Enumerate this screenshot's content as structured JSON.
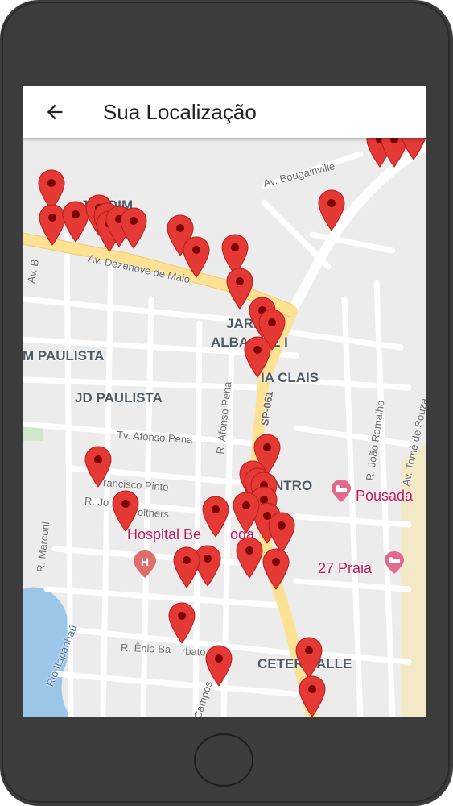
{
  "app": {
    "title": "Sua Localização"
  },
  "icons": {
    "back": "arrow-back-icon",
    "pin": "map-pin-icon",
    "hospital": "hospital-icon",
    "bed": "bed-icon"
  },
  "colors": {
    "pin": "#e53935",
    "pin_dot": "#7b0000",
    "poi": "#c2185b",
    "major_road": "#fde293",
    "water": "#9cc6e8"
  },
  "map": {
    "areas": {
      "jardim": "JARDIM",
      "jardim_alba": "JARDIM",
      "alba_rest": "ALBA",
      "alba_suffix": "Z I",
      "m_paulista": "M PAULISTA",
      "jd_paulista": "JD PAULISTA",
      "clais": "IA CLAIS",
      "centro": "NTRO",
      "ceter": "CETER",
      "alle": "ALLE"
    },
    "streets": {
      "av_bougainville": "Av. Bougainville",
      "av_dezenove": "Av. Dezenove de Maio",
      "av_b": "Av. B",
      "r_afonso": "R. Afonso Pena",
      "sp061": "SP-061",
      "tv_afonso": "Tv. Afonso Pena",
      "francisco": "rancisco Pinto",
      "r_jo": "R. Jo",
      "olthers": "olthers",
      "r_marconi": "R. Marconi",
      "rio": "Rio Itapanhaú",
      "r_enio": "R. Ênio Ba",
      "rbato": "rbato",
      "campos": "Campos",
      "r_joao_ramalho": "R. João Ramalho",
      "av_tome": "Av. Tomé de Souza"
    },
    "pois": {
      "pousada": "Pousada",
      "hospital_a": "Hospital Be",
      "hospital_b": "oga",
      "praia": "27 Praia"
    }
  }
}
